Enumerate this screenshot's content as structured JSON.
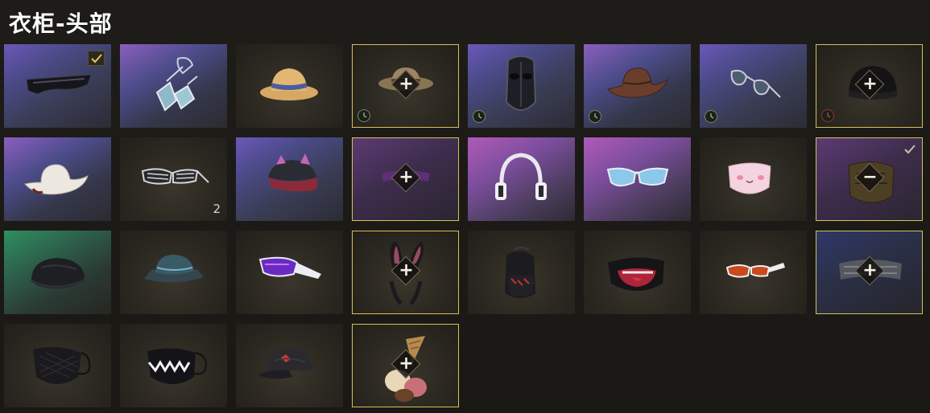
{
  "header": {
    "title": "衣柜-头部"
  },
  "grid": {
    "items": [
      {
        "icon": "visor-sunglasses-icon",
        "selected": false,
        "equipped": true,
        "action": "",
        "timer": false,
        "count": ""
      },
      {
        "icon": "goggles-icon",
        "selected": false,
        "equipped": false,
        "action": "",
        "timer": false,
        "count": ""
      },
      {
        "icon": "straw-hat-icon",
        "selected": false,
        "equipped": false,
        "action": "",
        "timer": false,
        "count": ""
      },
      {
        "icon": "fedora-hat-icon",
        "selected": true,
        "equipped": false,
        "action": "+",
        "timer": true,
        "count": ""
      },
      {
        "icon": "hockey-mask-icon",
        "selected": false,
        "equipped": false,
        "action": "",
        "timer": true,
        "count": ""
      },
      {
        "icon": "cowboy-hat-icon",
        "selected": false,
        "equipped": false,
        "action": "",
        "timer": true,
        "count": ""
      },
      {
        "icon": "aviator-sunglasses-icon",
        "selected": false,
        "equipped": false,
        "action": "",
        "timer": true,
        "count": ""
      },
      {
        "icon": "beanie-icon",
        "selected": true,
        "equipped": false,
        "action": "+",
        "timer": true,
        "count": ""
      },
      {
        "icon": "white-cowboy-hat-icon",
        "selected": false,
        "equipped": false,
        "action": "",
        "timer": false,
        "count": ""
      },
      {
        "icon": "shutter-shades-icon",
        "selected": false,
        "equipped": false,
        "action": "",
        "timer": false,
        "count": "2"
      },
      {
        "icon": "cat-ear-hat-icon",
        "selected": false,
        "equipped": false,
        "action": "",
        "timer": false,
        "count": ""
      },
      {
        "icon": "headband-icon",
        "selected": true,
        "equipped": false,
        "action": "+",
        "timer": false,
        "count": ""
      },
      {
        "icon": "headphones-icon",
        "selected": false,
        "equipped": false,
        "action": "",
        "timer": false,
        "count": ""
      },
      {
        "icon": "blue-sunglasses-icon",
        "selected": false,
        "equipped": false,
        "action": "",
        "timer": false,
        "count": ""
      },
      {
        "icon": "pink-mask-icon",
        "selected": false,
        "equipped": false,
        "action": "",
        "timer": false,
        "count": ""
      },
      {
        "icon": "tactical-mask-icon",
        "selected": true,
        "equipped": true,
        "action": "−",
        "timer": false,
        "count": ""
      },
      {
        "icon": "flat-cap-icon",
        "selected": false,
        "equipped": false,
        "action": "",
        "timer": false,
        "count": ""
      },
      {
        "icon": "bucket-hat-icon",
        "selected": false,
        "equipped": false,
        "action": "",
        "timer": false,
        "count": ""
      },
      {
        "icon": "purple-sunglasses-icon",
        "selected": false,
        "equipped": false,
        "action": "",
        "timer": false,
        "count": ""
      },
      {
        "icon": "bunny-ears-icon",
        "selected": true,
        "equipped": false,
        "action": "+",
        "timer": false,
        "count": ""
      },
      {
        "icon": "balaclava-icon",
        "selected": false,
        "equipped": false,
        "action": "",
        "timer": false,
        "count": ""
      },
      {
        "icon": "mouth-mask-icon",
        "selected": false,
        "equipped": false,
        "action": "",
        "timer": false,
        "count": ""
      },
      {
        "icon": "orange-sunglasses-icon",
        "selected": false,
        "equipped": false,
        "action": "",
        "timer": false,
        "count": ""
      },
      {
        "icon": "tuna-headband-icon",
        "selected": true,
        "equipped": false,
        "action": "+",
        "timer": false,
        "count": ""
      },
      {
        "icon": "black-mask-icon",
        "selected": false,
        "equipped": false,
        "action": "",
        "timer": false,
        "count": ""
      },
      {
        "icon": "teeth-mask-icon",
        "selected": false,
        "equipped": false,
        "action": "",
        "timer": false,
        "count": ""
      },
      {
        "icon": "baseball-cap-icon",
        "selected": false,
        "equipped": false,
        "action": "",
        "timer": false,
        "count": ""
      },
      {
        "icon": "ice-cream-hat-icon",
        "selected": true,
        "equipped": false,
        "action": "+",
        "timer": false,
        "count": ""
      }
    ]
  },
  "colors": {
    "background": "#1c1a17",
    "selected_border": "#d8bf5a",
    "check": "#e2c95a"
  }
}
